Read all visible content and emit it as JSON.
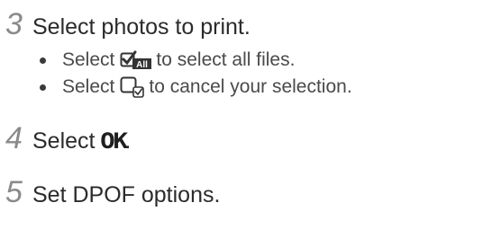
{
  "steps": [
    {
      "number": "3",
      "text": "Select photos to print.",
      "bullets": [
        {
          "prefix": "Select",
          "icon": "select-all-icon",
          "icon_text": "All",
          "suffix": "to select all files."
        },
        {
          "prefix": "Select",
          "icon": "cancel-selection-icon",
          "suffix": "to cancel your selection."
        }
      ]
    },
    {
      "number": "4",
      "text": "Select",
      "button_label": "OK",
      "suffix": "."
    },
    {
      "number": "5",
      "text": "Set DPOF options."
    }
  ],
  "colors": {
    "step_number": "#8a8a8a",
    "text": "#2b2b2b",
    "bullet_text": "#4a4a4a"
  }
}
